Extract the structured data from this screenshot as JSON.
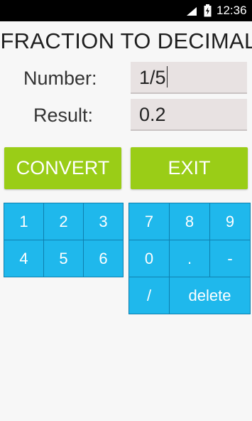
{
  "status_bar": {
    "time": "12:36",
    "icons": [
      "wifi-icon",
      "battery-charging-icon"
    ]
  },
  "app": {
    "title": "FRACTION TO DECIMAL"
  },
  "form": {
    "number_label": "Number:",
    "number_value": "1/5",
    "result_label": "Result:",
    "result_value": "0.2"
  },
  "actions": {
    "convert_label": "CONVERT",
    "exit_label": "EXIT"
  },
  "keypad": {
    "k1": "1",
    "k2": "2",
    "k3": "3",
    "k4": "4",
    "k5": "5",
    "k6": "6",
    "k7": "7",
    "k8": "8",
    "k9": "9",
    "k0": "0",
    "dot": ".",
    "minus": "-",
    "slash": "/",
    "delete": "delete"
  },
  "colors": {
    "accent_green": "#9acd17",
    "key_blue": "#1fb8ec",
    "field_bg": "#e8e2e2",
    "background": "#f7f7f7"
  }
}
